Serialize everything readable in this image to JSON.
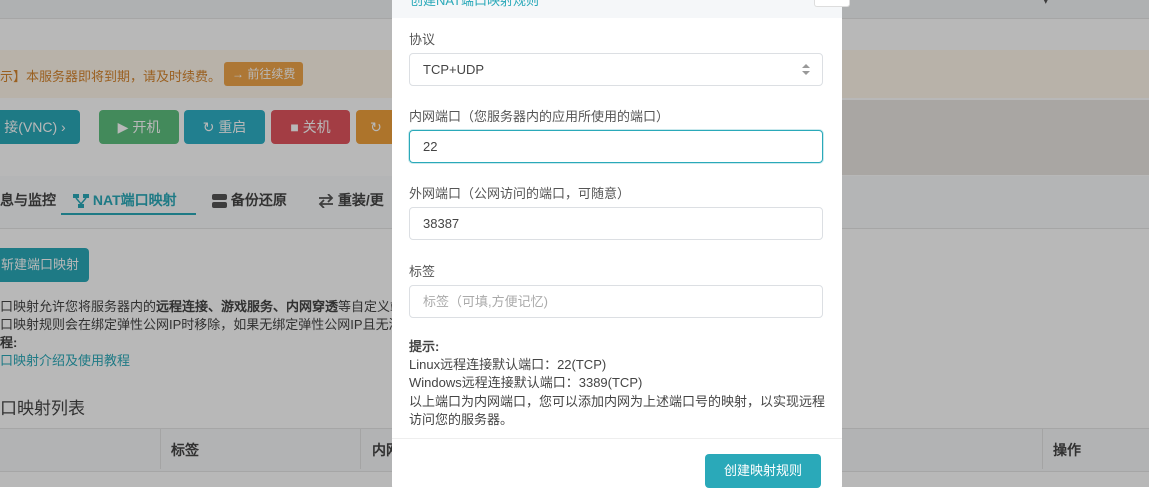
{
  "background": {
    "header_fragment": "▾",
    "alert": {
      "text": "示】本服务器即将到期，请及时续费。",
      "renew_label": "→ 前往续费"
    },
    "actions": {
      "vnc_label": "接(VNC)  ›",
      "power_on_label": "▶ 开机",
      "reboot_label": "↻ 重启",
      "power_off_label": "■ 关机",
      "reinstall_label": "↻"
    },
    "tabs": [
      {
        "label": "息与监控"
      },
      {
        "label": "NAT端口映射"
      },
      {
        "label": "备份还原"
      },
      {
        "label": "重装/更"
      }
    ],
    "create_button_label": "斩建端口映射",
    "desc_line1_prefix": "口映射允许您将服务器内的",
    "desc_line1_bold": "远程连接、游戏服务、内网穿透",
    "desc_line1_suffix": "等自定义端",
    "desc_line2": "口映射规则会在绑定弹性公网IP时移除，如果无绑定弹性公网IP且无添",
    "desc_line3": "程:",
    "desc_link": "口映射介绍及使用教程",
    "list_title": "口映射列表",
    "table_headers": {
      "tag": "标签",
      "inner": "内网",
      "ops": "操作"
    }
  },
  "modal": {
    "title": "创建NAT端口映射规则",
    "protocol": {
      "label": "协议",
      "value": "TCP+UDP"
    },
    "inner_port": {
      "label": "内网端口（您服务器内的应用所使用的端口）",
      "value": "22"
    },
    "outer_port": {
      "label": "外网端口（公网访问的端口，可随意）",
      "value": "38387"
    },
    "tag": {
      "label": "标签",
      "placeholder": "标签（可填,方便记忆)"
    },
    "tips": {
      "title": "提示:",
      "line1": "Linux远程连接默认端口：22(TCP)",
      "line2": "Windows远程连接默认端口：3389(TCP)",
      "line3": "以上端口为内网端口，您可以添加内网为上述端口号的映射，以实现远程",
      "line4": "访问您的服务器。"
    },
    "submit_label": "创建映射规则"
  },
  "colors": {
    "accent": "#2aa9b9",
    "danger": "#e2555f",
    "success": "#5dbf7f",
    "warning": "#f0a13c"
  }
}
